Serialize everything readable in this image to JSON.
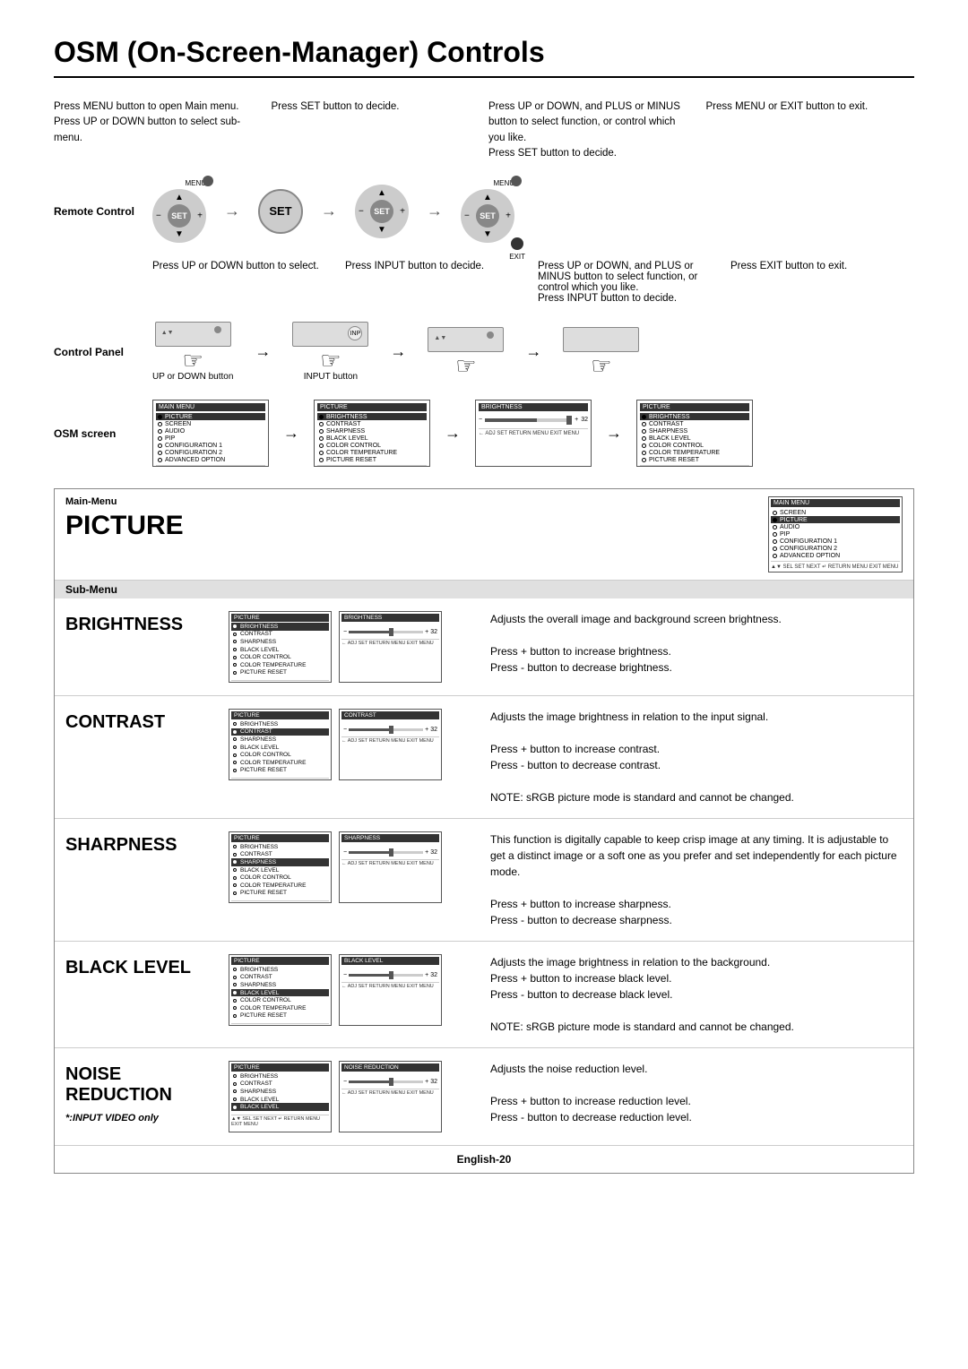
{
  "page": {
    "title": "OSM (On-Screen-Manager) Controls",
    "pageNumber": "English-20"
  },
  "topInstructions": [
    {
      "id": "instr1",
      "text": "Press MENU button to open Main menu.\nPress UP or DOWN button to select sub-menu."
    },
    {
      "id": "instr2",
      "text": "Press SET button to decide."
    },
    {
      "id": "instr3",
      "text": "Press UP or DOWN, and PLUS or MINUS button to select function, or control which you like.\nPress SET button to decide."
    },
    {
      "id": "instr4",
      "text": "Press MENU or EXIT button to exit."
    }
  ],
  "bottomInstructions": [
    {
      "id": "binstr1",
      "text": "Press UP or DOWN button to select."
    },
    {
      "id": "binstr2",
      "text": "Press INPUT button to decide."
    },
    {
      "id": "binstr3",
      "text": "Press UP or DOWN, and PLUS or MINUS button to select function, or control which you like.\nPress INPUT button to decide."
    },
    {
      "id": "binstr4",
      "text": "Press EXIT button to exit."
    }
  ],
  "labels": {
    "remoteControl": "Remote Control",
    "controlPanel": "Control Panel",
    "osmScreen": "OSM screen",
    "mainMenu": "Main-Menu",
    "picture": "PICTURE",
    "subMenu": "Sub-Menu",
    "upDownButton": "UP or DOWN button",
    "inputButton": "INPUT button",
    "menuLabel": "MENU",
    "exitLabel": "EXIT"
  },
  "mainMenuItems": [
    {
      "label": "PICTURE",
      "selected": true
    },
    {
      "label": "SCREEN",
      "selected": false
    },
    {
      "label": "AUDIO",
      "selected": false
    },
    {
      "label": "PIP",
      "selected": false
    },
    {
      "label": "CONFIGURATION 1",
      "selected": false
    },
    {
      "label": "CONFIGURATION 2",
      "selected": false
    },
    {
      "label": "ADVANCED OPTION",
      "selected": false
    }
  ],
  "pictureMenuItems": [
    {
      "label": "BRIGHTNESS",
      "selected": true
    },
    {
      "label": "CONTRAST",
      "selected": false
    },
    {
      "label": "SHARPNESS",
      "selected": false
    },
    {
      "label": "BLACK LEVEL",
      "selected": false
    },
    {
      "label": "COLOR CONTROL",
      "selected": false
    },
    {
      "label": "COLOR TEMPERATURE",
      "selected": false
    },
    {
      "label": "PICTURE RESET",
      "selected": false
    }
  ],
  "features": [
    {
      "id": "brightness",
      "name": "BRIGHTNESS",
      "menuHighlight": "BRIGHTNESS",
      "sliderLabel": "BRIGHTNESS",
      "description": "Adjusts the overall image and background screen brightness.",
      "pressPlus": "Press + button to increase brightness.",
      "pressMinus": "Press - button to decrease brightness."
    },
    {
      "id": "contrast",
      "name": "CONTRAST",
      "menuHighlight": "CONTRAST",
      "sliderLabel": "CONTRAST",
      "description": "Adjusts the image brightness in relation to the input signal.",
      "pressPlus": "Press + button to increase contrast.",
      "pressMinus": "Press - button to decrease contrast.",
      "note": "NOTE: sRGB picture mode is standard and cannot be changed."
    },
    {
      "id": "sharpness",
      "name": "SHARPNESS",
      "menuHighlight": "SHARPNESS",
      "sliderLabel": "SHARPNESS",
      "description": "This function is digitally capable to keep crisp image at any timing. It is adjustable to get a distinct image or a soft one as you prefer and set independently for each picture mode.",
      "pressPlus": "Press + button to increase sharpness.",
      "pressMinus": "Press - button to decrease sharpness."
    },
    {
      "id": "blacklevel",
      "name": "BLACK LEVEL",
      "menuHighlight": "BLACK LEVEL",
      "sliderLabel": "BLACK LEVEL",
      "description": "Adjusts the image brightness in relation to the background.",
      "pressPlus": "Press + button to increase black level.",
      "pressMinus": "Press - button to decrease black level.",
      "note": "NOTE: sRGB picture mode is standard and cannot be changed."
    },
    {
      "id": "noisereduction",
      "name": "NOISE REDUCTION",
      "menuHighlight": "NOISE REDUCTION",
      "sliderLabel": "NOISE REDUCTION",
      "description": "Adjusts the noise reduction level.",
      "pressPlus": "Press + button to increase reduction level.",
      "pressMinus": "Press - button to decrease reduction level.",
      "footnote": "*:INPUT VIDEO only"
    }
  ]
}
